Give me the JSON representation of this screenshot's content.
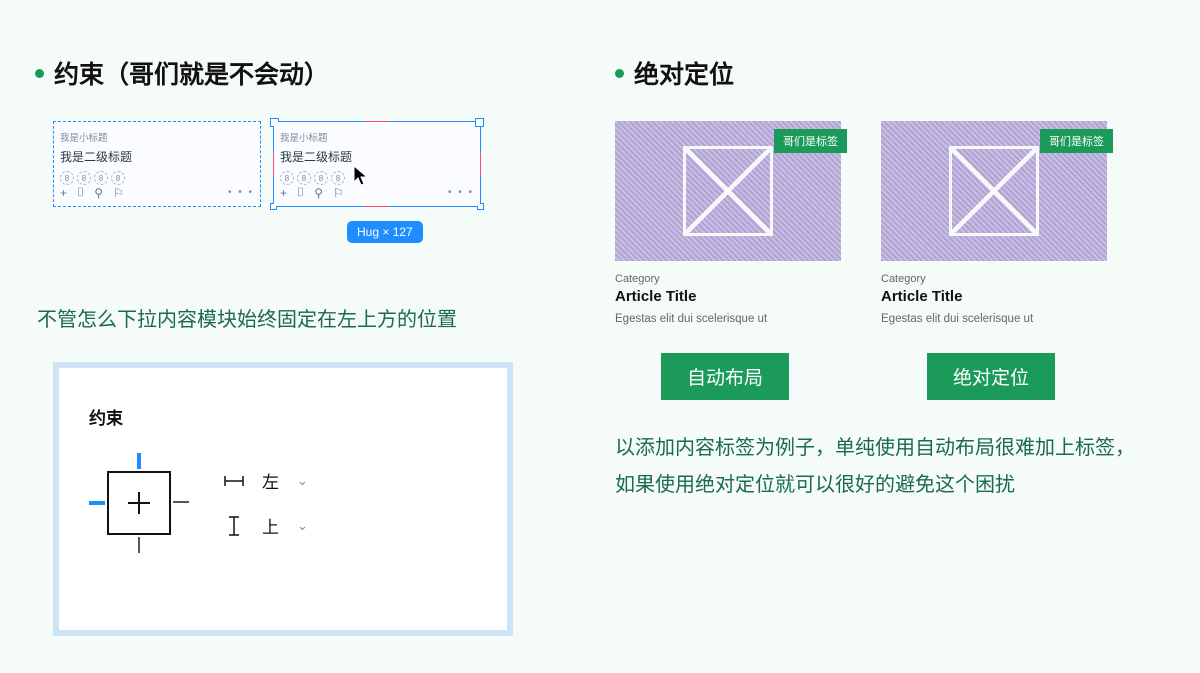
{
  "left": {
    "heading": "约束（哥们就是不会动）",
    "preview": {
      "subtitle": "我是小标题",
      "title": "我是二级标题",
      "avatarGlyph": "8",
      "toolbar": {
        "plus": "+",
        "icon1": "⌷",
        "icon2": "⚲",
        "icon3": "⚐"
      },
      "dots": "• • •",
      "sizeLabel": "Hug × 127"
    },
    "paragraph": "不管怎么下拉内容模块始终固定在左上方的位置",
    "panel": {
      "title": "约束",
      "horizontal": "左",
      "vertical": "上"
    }
  },
  "right": {
    "heading": "绝对定位",
    "badge": "哥们是标签",
    "card": {
      "category": "Category",
      "title": "Article Title",
      "desc": "Egestas elit dui scelerisque ut"
    },
    "labelA": "自动布局",
    "labelB": "绝对定位",
    "paragraph": "以添加内容标签为例子，单纯使用自动布局很难加上标签，如果使用绝对定位就可以很好的避免这个困扰"
  }
}
